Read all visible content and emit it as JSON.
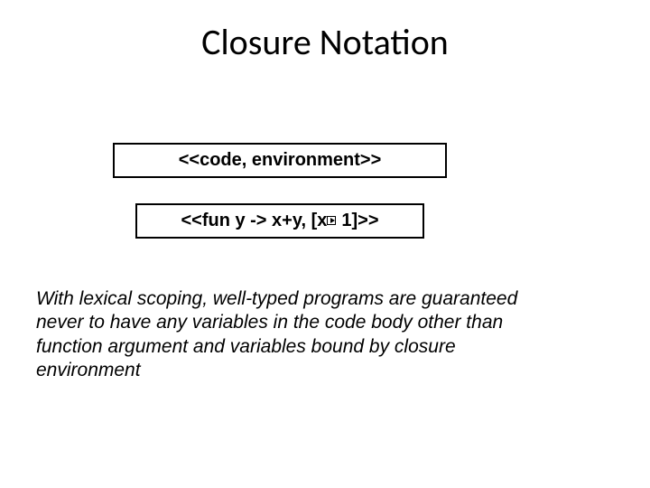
{
  "title": "Closure Notation",
  "box1": "<<code, environment>>",
  "box2_prefix": "<<fun y -> x+y, [x",
  "box2_suffix": "1]>>",
  "body": "With lexical scoping, well-typed programs are guaranteed never to have any variables in the code body other than function argument and variables bound by closure environment"
}
